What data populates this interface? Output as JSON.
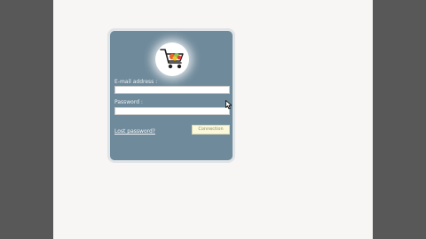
{
  "login": {
    "email_label": "E-mail address :",
    "email_value": "",
    "password_label": "Password :",
    "password_value": "",
    "lost_password_link": "Lost password?",
    "submit_label": "Connection"
  },
  "icons": {
    "logo": "shopping-cart-icon",
    "cursor": "mouse-pointer-icon"
  },
  "colors": {
    "card_background": "#6f8a9b",
    "button_background": "#fbf9d9",
    "page_background": "#f7f6f5",
    "outer_background": "#585858"
  }
}
